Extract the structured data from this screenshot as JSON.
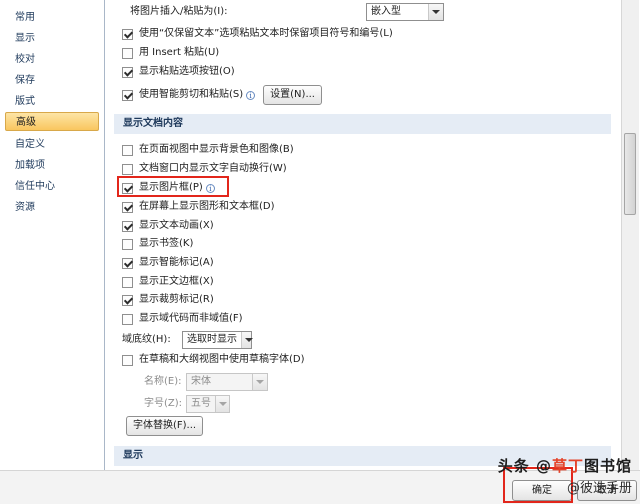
{
  "nav": {
    "items": [
      {
        "label": "常用"
      },
      {
        "label": "显示"
      },
      {
        "label": "校对"
      },
      {
        "label": "保存"
      },
      {
        "label": "版式"
      },
      {
        "label": "高级",
        "active": true
      },
      {
        "label": "自定义"
      },
      {
        "label": "加载项"
      },
      {
        "label": "信任中心"
      },
      {
        "label": "资源"
      }
    ]
  },
  "paste": {
    "insert_label": "将图片插入/粘贴为(I):",
    "insert_value": "嵌入型",
    "keep_bullets_label": "使用“仅保留文本”选项粘贴文本时保留项目符号和编号(L)",
    "keep_bullets_checked": true,
    "insert_key_label": "用 Insert 粘贴(U)",
    "insert_key_checked": false,
    "show_options_label": "显示粘贴选项按钮(O)",
    "show_options_checked": true,
    "smart_cut_label": "使用智能剪切和粘贴(S)",
    "smart_cut_checked": true,
    "settings_button": "设置(N)..."
  },
  "show_doc": {
    "header": "显示文档内容",
    "items": [
      {
        "label": "在页面视图中显示背景色和图像(B)",
        "checked": false
      },
      {
        "label": "文档窗口内显示文字自动换行(W)",
        "checked": false
      },
      {
        "label": "显示图片框(P)",
        "checked": true
      },
      {
        "label": "在屏幕上显示图形和文本框(D)",
        "checked": true
      },
      {
        "label": "显示文本动画(X)",
        "checked": true
      },
      {
        "label": "显示书签(K)",
        "checked": false
      },
      {
        "label": "显示智能标记(A)",
        "checked": true
      },
      {
        "label": "显示正文边框(X)",
        "checked": false
      },
      {
        "label": "显示裁剪标记(R)",
        "checked": true
      },
      {
        "label": "显示域代码而非域值(F)",
        "checked": false
      }
    ],
    "field_shading_label": "域底纹(H):",
    "field_shading_value": "选取时显示",
    "draft_font_label": "在草稿和大纲视图中使用草稿字体(D)",
    "draft_font_checked": false,
    "font_name_label": "名称(E):",
    "font_name_value": "宋体",
    "font_size_label": "字号(Z):",
    "font_size_value": "五号",
    "font_substitution_button": "字体替换(F)..."
  },
  "display_section": {
    "header": "显示"
  },
  "dialog": {
    "ok": "确定",
    "cancel": "取消"
  },
  "watermark": {
    "line1_prefix": "头条 @",
    "line1_accent": "草丁",
    "line1_suffix": "图书馆",
    "line2": "@彼迭手册"
  },
  "colors": {
    "section_header_bg": "#e5ecf5",
    "nav_active": "#f9c65f",
    "highlight": "#e2261b"
  }
}
